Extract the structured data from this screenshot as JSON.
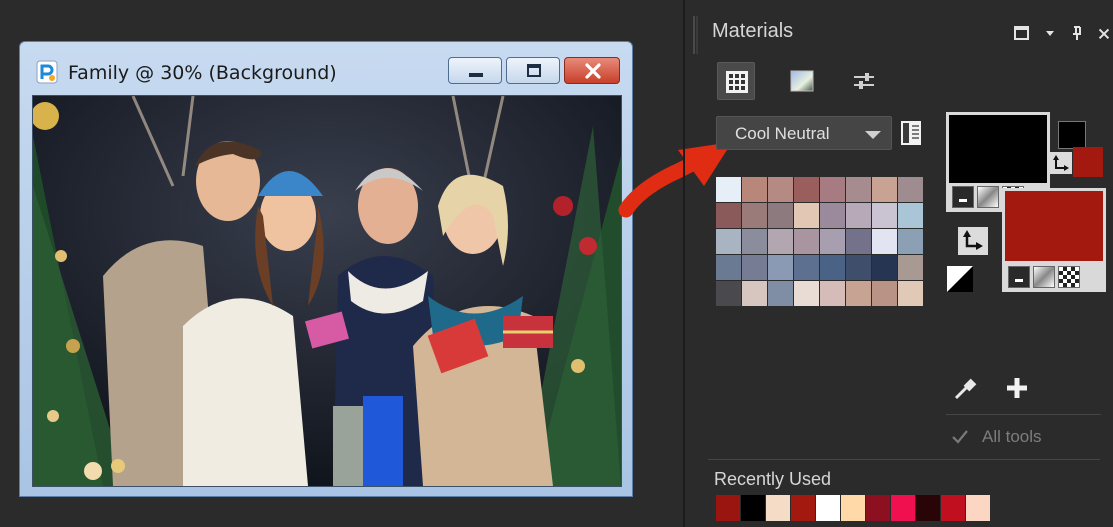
{
  "document": {
    "title": "Family @  30% (Background)"
  },
  "materials": {
    "title": "Materials",
    "modes": [
      "swatches-mode-icon",
      "gradient-mode-icon",
      "adjust-mode-icon"
    ],
    "palette_select": "Cool Neutral",
    "swatches": [
      "#e6eef8",
      "#b9877a",
      "#b58a82",
      "#9a5e5c",
      "#a67c82",
      "#a68c8f",
      "#c8a394",
      "#9f8c90",
      "#8a5a5a",
      "#9b7b7a",
      "#8c7a7e",
      "#e2c7b4",
      "#9a8a9c",
      "#b8a9b9",
      "#c9c3d2",
      "#a9c5d6",
      "#a8b4c2",
      "#8c8d9c",
      "#b2a6b1",
      "#a9959f",
      "#a79fb0",
      "#73728a",
      "#e2e4f2",
      "#8ba0b5",
      "#6a7a92",
      "#767c94",
      "#8a9ab4",
      "#5d7090",
      "#4a6286",
      "#3f4e6a",
      "#253552",
      "#a89a92",
      "#4a4a4e",
      "#d7c6c0",
      "#7f8ea4",
      "#e8dcd5",
      "#d6bcb8",
      "#c7a394",
      "#b99386",
      "#e0c9b6"
    ],
    "foreground_color": "#000000",
    "background_color": "#a3180f",
    "all_tools_label": "All tools",
    "all_tools_checked": true,
    "recently_used_label": "Recently Used",
    "recent_colors": [
      "#9b1510",
      "#000000",
      "#f5dcc6",
      "#a3180f",
      "#ffffff",
      "#ffd9a8",
      "#8c1020",
      "#f01050",
      "#2a0508",
      "#c01020",
      "#fbd6c2"
    ]
  }
}
